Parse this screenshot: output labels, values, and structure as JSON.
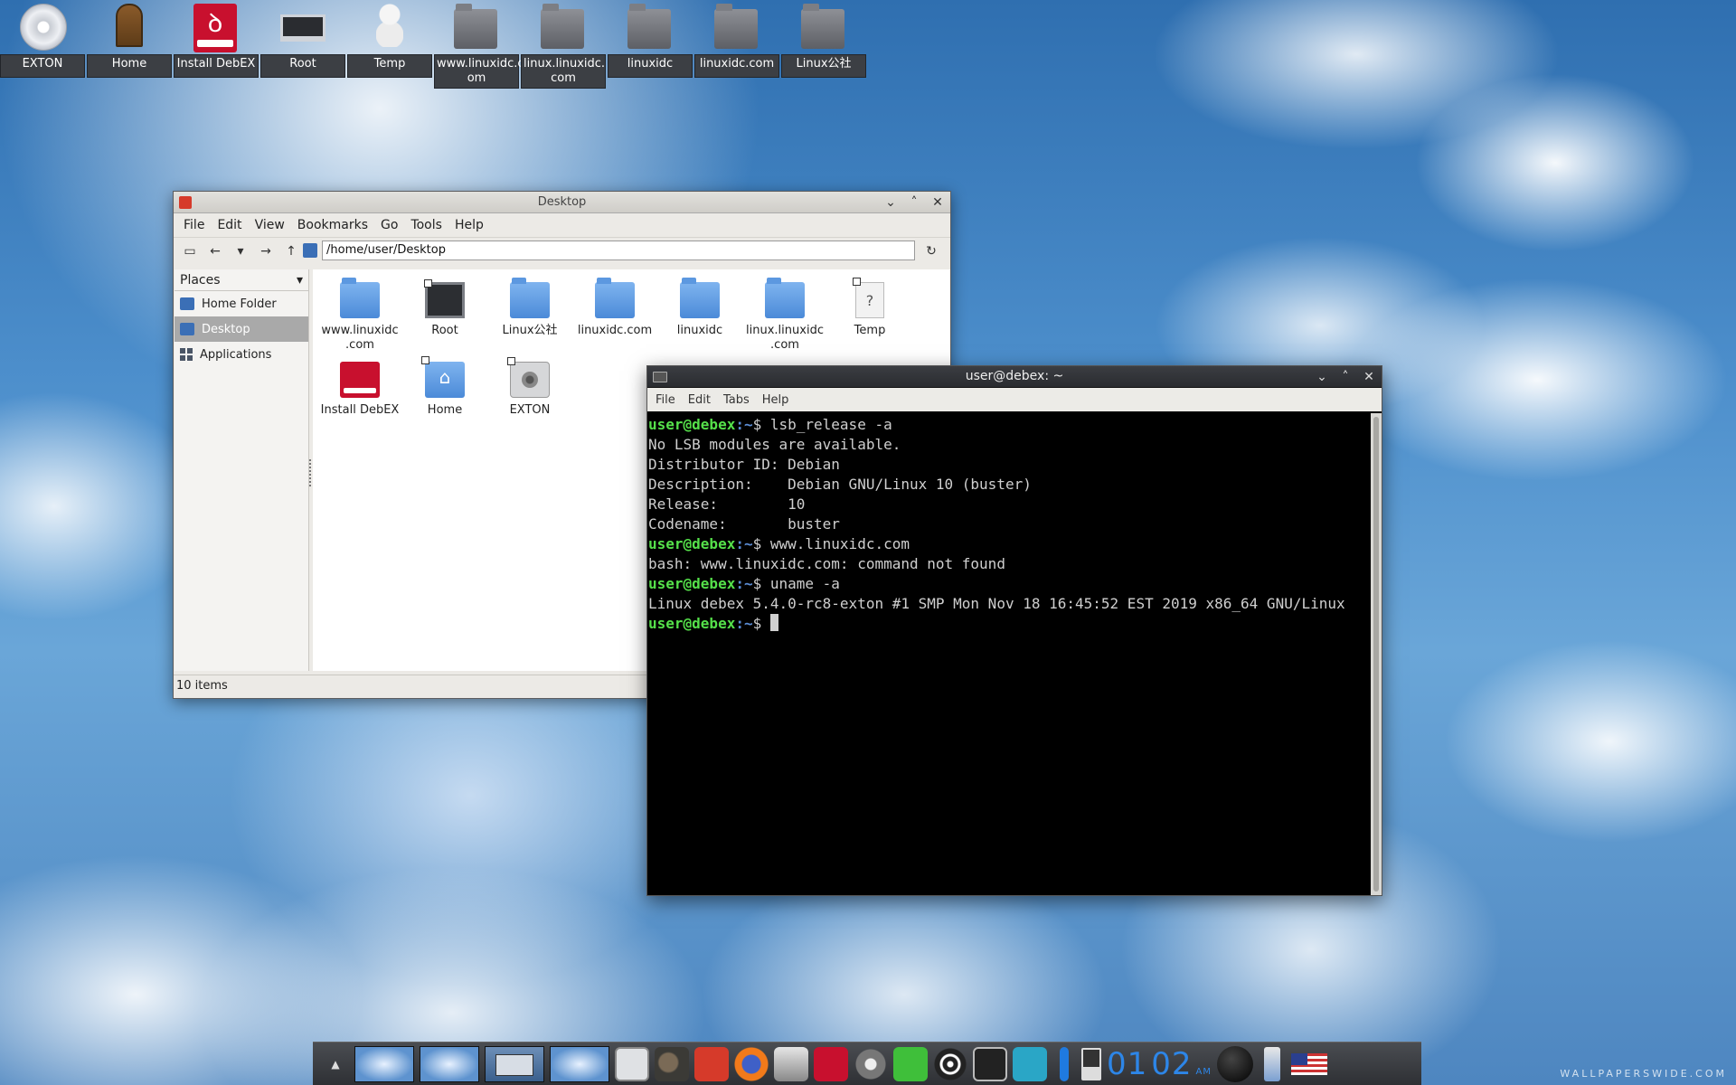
{
  "desktop_icons": [
    {
      "label": "EXTON",
      "icon": "cd-icon"
    },
    {
      "label": "Home",
      "icon": "door-icon"
    },
    {
      "label": "Install DebEX",
      "icon": "debian-installer-icon"
    },
    {
      "label": "Root",
      "icon": "laptop-icon"
    },
    {
      "label": "Temp",
      "icon": "snowman-icon"
    },
    {
      "label": "www.linuxidc.c\nom",
      "icon": "folder-icon"
    },
    {
      "label": "linux.linuxidc.\ncom",
      "icon": "folder-icon"
    },
    {
      "label": "linuxidc",
      "icon": "folder-icon"
    },
    {
      "label": "linuxidc.com",
      "icon": "folder-icon"
    },
    {
      "label": "Linux公社",
      "icon": "folder-icon"
    }
  ],
  "file_manager": {
    "title": "Desktop",
    "menu": [
      "File",
      "Edit",
      "View",
      "Bookmarks",
      "Go",
      "Tools",
      "Help"
    ],
    "location": "/home/user/Desktop",
    "sidebar": {
      "header": "Places",
      "items": [
        {
          "label": "Home Folder",
          "active": false
        },
        {
          "label": "Desktop",
          "active": true
        },
        {
          "label": "Applications",
          "active": false
        }
      ]
    },
    "files": [
      {
        "label": "www.linuxidc\n.com",
        "icon": "folder-icon"
      },
      {
        "label": "Root",
        "icon": "monitor-icon"
      },
      {
        "label": "Linux公社",
        "icon": "folder-icon"
      },
      {
        "label": "linuxidc.com",
        "icon": "folder-icon"
      },
      {
        "label": "linuxidc",
        "icon": "folder-icon"
      },
      {
        "label": "linux.linuxidc\n.com",
        "icon": "folder-icon"
      },
      {
        "label": "Temp",
        "icon": "unknown-file-icon"
      },
      {
        "label": "Install DebEX",
        "icon": "debian-installer-icon"
      },
      {
        "label": "Home",
        "icon": "home-folder-icon"
      },
      {
        "label": "EXTON",
        "icon": "disk-icon"
      }
    ],
    "status": "10 items"
  },
  "terminal": {
    "title": "user@debex: ~",
    "menu": [
      "File",
      "Edit",
      "Tabs",
      "Help"
    ],
    "prompt_user": "user@debex",
    "prompt_path": ":~",
    "prompt_symbol": "$ ",
    "commands": [
      "lsb_release -a",
      "www.linuxidc.com",
      "uname -a"
    ],
    "outputs": [
      [
        "No LSB modules are available.",
        "Distributor ID: Debian",
        "Description:    Debian GNU/Linux 10 (buster)",
        "Release:        10",
        "Codename:       buster"
      ],
      [
        "bash: www.linuxidc.com: command not found"
      ],
      [
        "Linux debex 5.4.0-rc8-exton #1 SMP Mon Nov 18 16:45:52 EST 2019 x86_64 GNU/Linux"
      ]
    ]
  },
  "dock": {
    "clock_hours": "01",
    "clock_minutes": "02",
    "clock_ampm": "AM",
    "apps": [
      "terminal-icon",
      "gimp-icon",
      "file-manager-icon",
      "firefox-icon",
      "system-monitor-icon",
      "debian-installer-icon",
      "video-icon",
      "download-icon",
      "network-icon",
      "display-icon",
      "screenshot-icon"
    ]
  },
  "watermark": "WALLPAPERSWIDE.COM",
  "colors": {
    "prompt_user": "#55e04a",
    "prompt_path": "#5b8dd6",
    "clock": "#2d86e8",
    "sidebar_active": "#a9a9a9"
  }
}
